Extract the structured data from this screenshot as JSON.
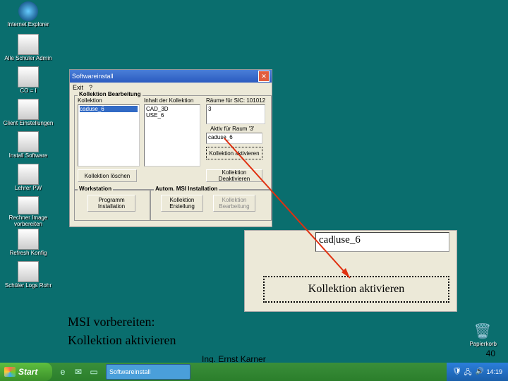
{
  "desktop_icons": [
    {
      "label": "Internet Explorer"
    },
    {
      "label": "Alle Schüler Admin"
    },
    {
      "label": "CO = I"
    },
    {
      "label": "Client Einstellungen"
    },
    {
      "label": "Install Software"
    },
    {
      "label": "Lehrer PW"
    },
    {
      "label": "Rechner Image vorbereiten"
    },
    {
      "label": "Refresh Konfig"
    },
    {
      "label": "Schüler Logs Rohr"
    }
  ],
  "dialog": {
    "title": "Softwareinstall",
    "menu": [
      "Exit",
      "?"
    ],
    "main_group_label": "Kollektion Bearbeitung",
    "col_kollektion": "Kollektion",
    "col_inhalt": "Inhalt der Kollektion",
    "col_raeume": "Räume für SIC: 101012",
    "kollektion_item": "caduse_6",
    "inhalt_items": [
      "CAD_3D",
      "USE_6"
    ],
    "raum_item": "3",
    "aktiv_label": "Aktiv für Raum '3'",
    "aktiv_value": "caduse_6",
    "btn_aktivieren": "Kollektion aktivieren",
    "btn_loeschen": "Kollektion löschen",
    "btn_deaktivieren": "Kollektion Deaktivieren",
    "ws_group_label": "Workstation",
    "autom_group_label": "Autom. MSI Installation",
    "btn_programm": "Programm Installation",
    "btn_kerst": "Kollektion Erstellung",
    "btn_kbearb": "Kollektion Bearbeitung"
  },
  "zoom": {
    "text_value": "cad|use_6",
    "button_label": "Kollektion aktivieren"
  },
  "slide": {
    "line1": "MSI vorbereiten:",
    "line2": "Kollektion aktivieren",
    "footer": "Ing. Ernst Karner",
    "page_number": "40"
  },
  "recycle_label": "Papierkorb",
  "taskbar": {
    "start": "Start",
    "task_button": "Softwareinstall",
    "clock": "14:19"
  }
}
